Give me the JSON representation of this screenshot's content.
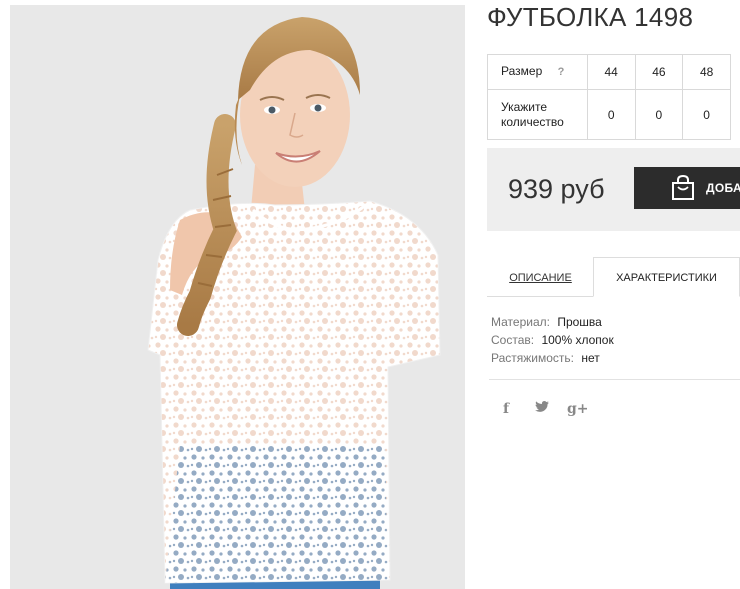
{
  "product": {
    "title": "ФУТБОЛКА 1498",
    "photo_alt": "Model wearing white eyelet lace t-shirt"
  },
  "size_table": {
    "size_label": "Размер",
    "help_symbol": "?",
    "sizes": [
      "44",
      "46",
      "48"
    ],
    "qty_label_line1": "Укажите",
    "qty_label_line2": "количество",
    "quantities": [
      "0",
      "0",
      "0"
    ]
  },
  "purchase": {
    "price": "939 руб",
    "add_to_cart_label": "ДОБАВ",
    "cart_icon": "shopping-bag-icon"
  },
  "tabs": [
    {
      "label": "ОПИСАНИЕ",
      "active": false
    },
    {
      "label": "ХАРАКТЕРИСТИКИ",
      "active": true
    }
  ],
  "specs": [
    {
      "key": "Материал:",
      "value": "Прошва"
    },
    {
      "key": "Состав:",
      "value": "100% хлопок"
    },
    {
      "key": "Растяжимость:",
      "value": "нет"
    }
  ],
  "social": [
    {
      "icon": "facebook-icon",
      "glyph": "f"
    },
    {
      "icon": "twitter-icon",
      "glyph": "t"
    },
    {
      "icon": "google-plus-icon",
      "glyph": "g+"
    }
  ],
  "colors": {
    "button_bg": "#2c2c2c",
    "price_box_bg": "#eeeeee",
    "photo_bg": "#e6e6e6",
    "border": "#d9d9d9"
  }
}
